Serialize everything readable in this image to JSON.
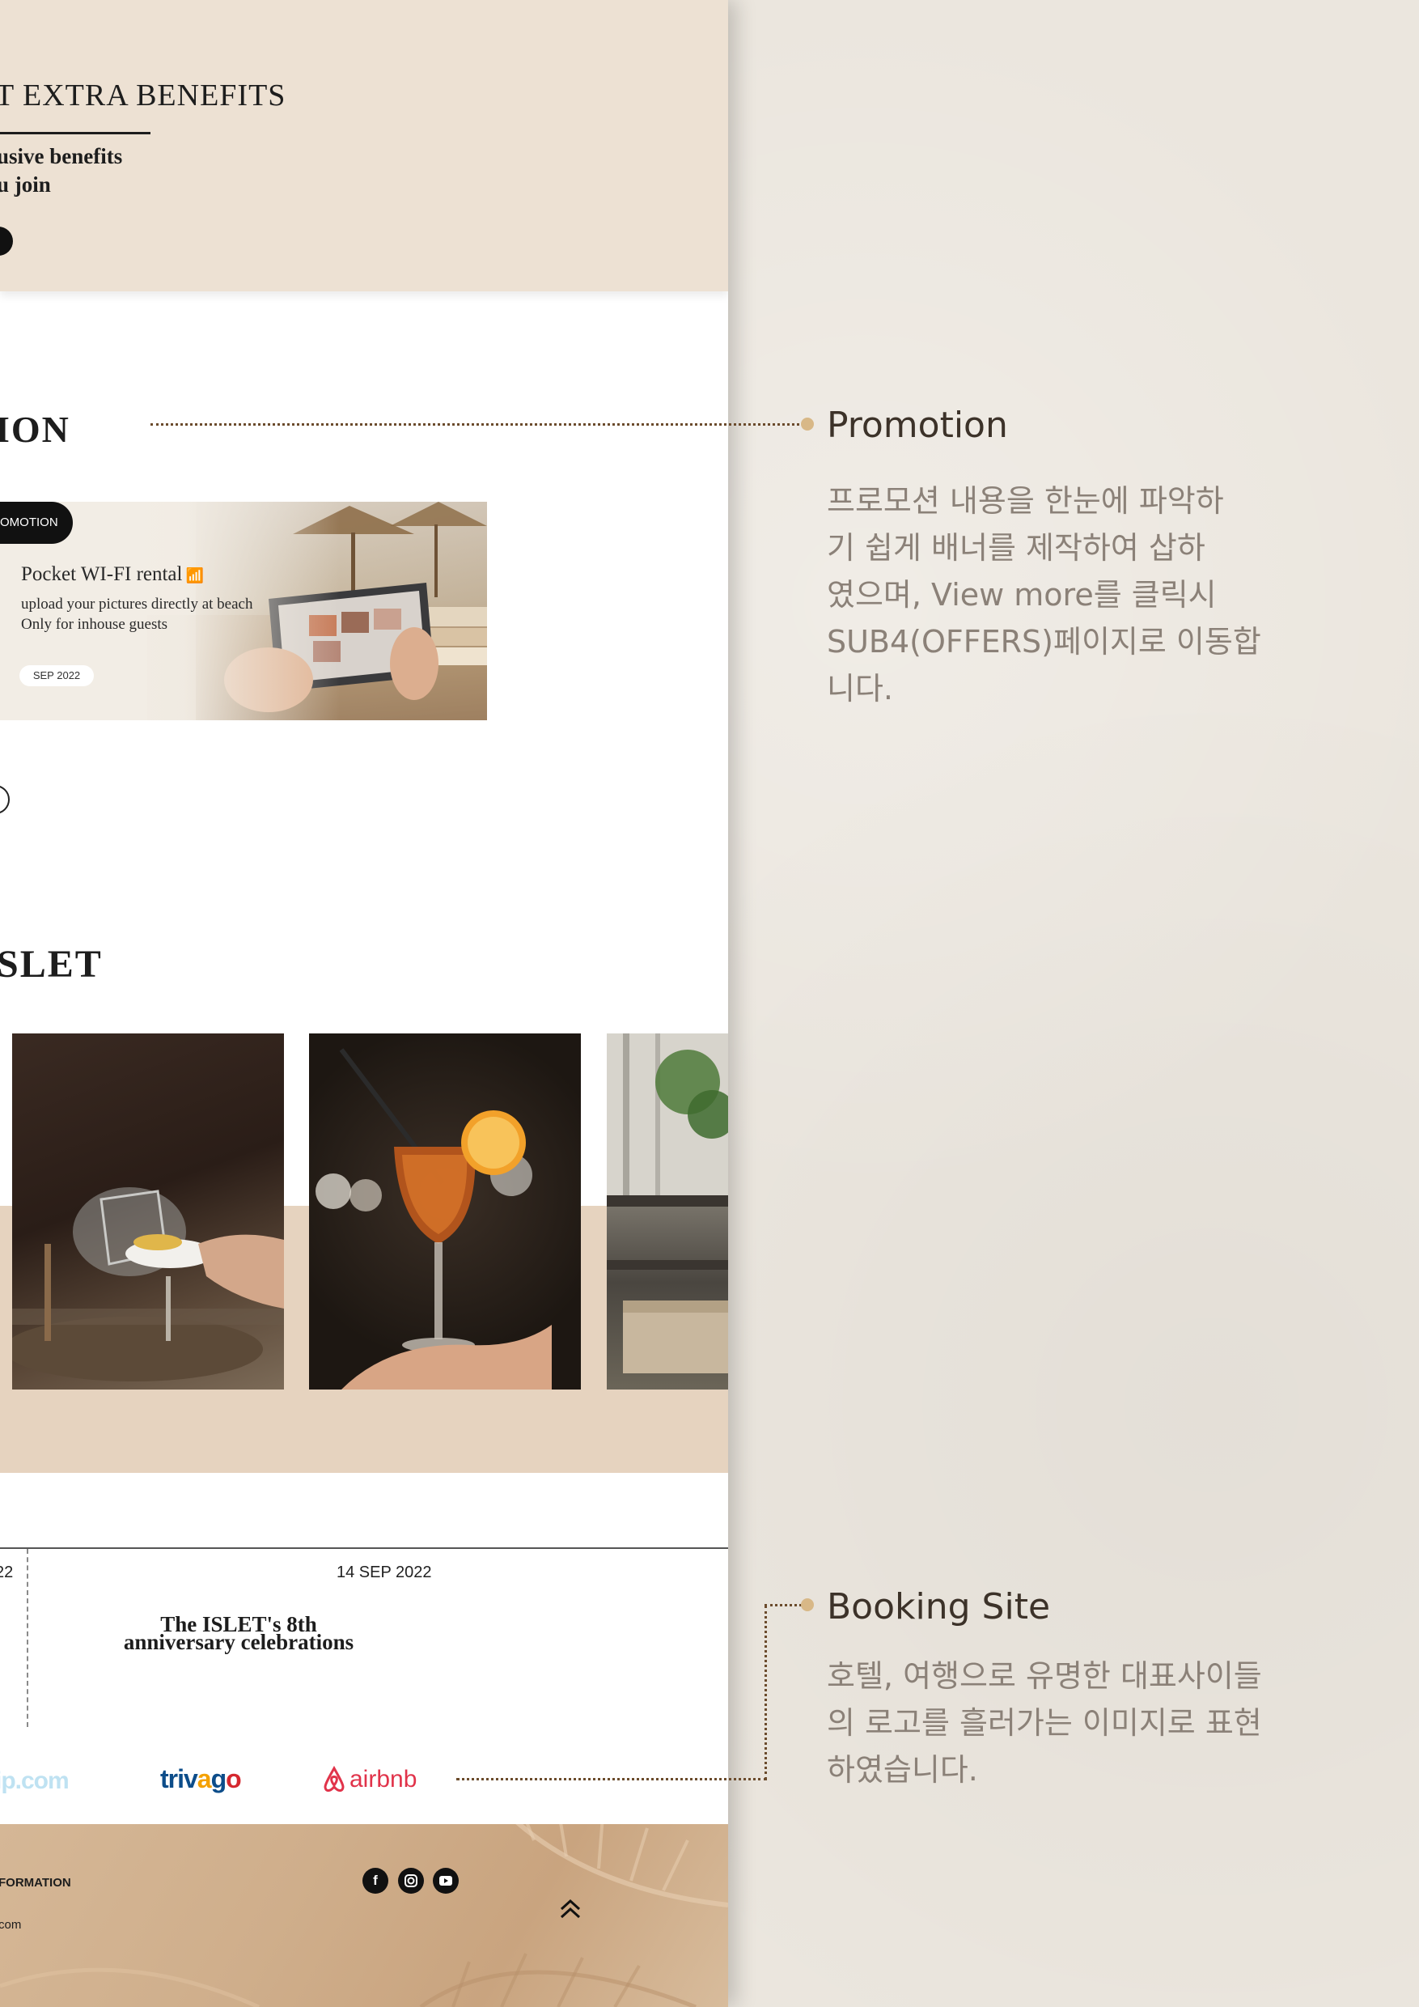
{
  "benefits": {
    "title": "T EXTRA BENEFITS",
    "subtitle_line1": "usive benefits",
    "subtitle_line2": "u join"
  },
  "promotion": {
    "section_title": "ION",
    "tag": "OMOTION",
    "banner_title": "Pocket WI-FI rental",
    "banner_line1": "upload your pictures directly at beach",
    "banner_line2": "Only for inhouse guests",
    "banner_date": "SEP 2022"
  },
  "islet": {
    "section_title": "SLET"
  },
  "news": {
    "left_date": "22",
    "date": "14 SEP 2022",
    "title": "The ISLET's 8th anniversary celebrations"
  },
  "booking_logos": {
    "partial": "ip.com",
    "trivago": "trivago",
    "airbnb": "airbnb"
  },
  "footer": {
    "info_label": "FORMATION",
    "email": "com",
    "social": [
      "facebook-icon",
      "instagram-icon",
      "youtube-icon"
    ],
    "top_button_icon": "double-chevron-up-icon"
  },
  "annotations": {
    "promotion": {
      "title": "Promotion",
      "body": "프로모션 내용을 한눈에 파악하\n기 쉽게 배너를 제작하여 삽하\n였으며, View more를 클릭시\nSUB4(OFFERS)페이지로 이동합\n니다."
    },
    "booking": {
      "title": "Booking Site",
      "body": "호텔, 여행으로 유명한 대표사이들\n의 로고를 흘러가는 이미지로 표현\n하였습니다."
    }
  },
  "colors": {
    "benefits_bg": "#ede1d3",
    "accent_dot": "#d8b887",
    "connector": "#6b4b2c",
    "footer_bg": "#cfae8b"
  }
}
